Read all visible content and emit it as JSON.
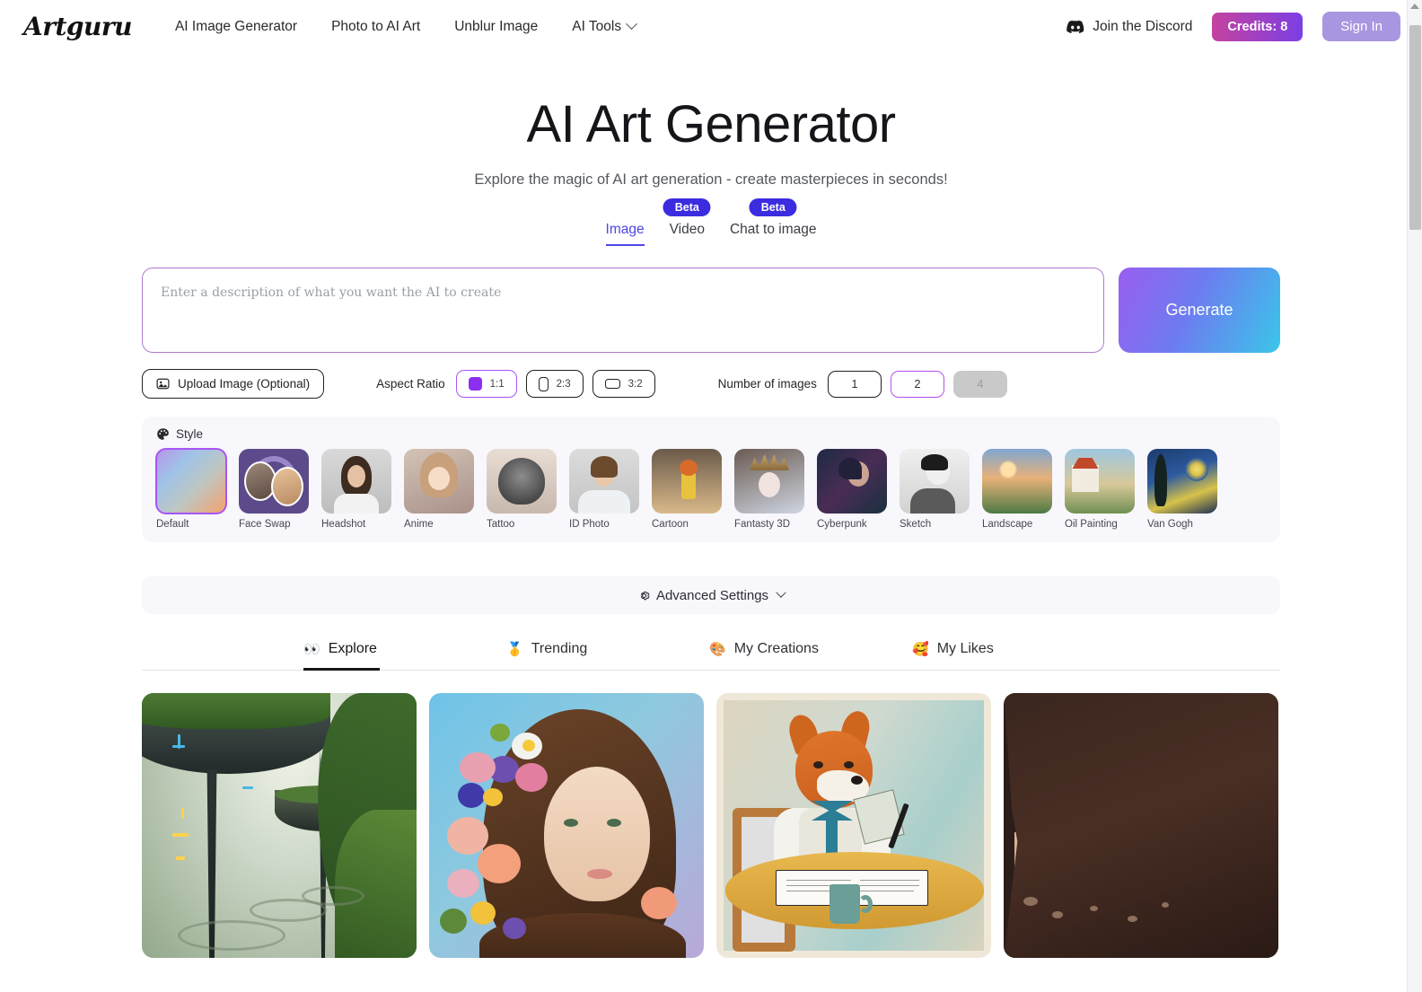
{
  "header": {
    "logo": "Artguru",
    "nav": [
      {
        "label": "AI Image Generator",
        "has_chevron": false
      },
      {
        "label": "Photo to AI Art",
        "has_chevron": false
      },
      {
        "label": "Unblur Image",
        "has_chevron": false
      },
      {
        "label": "AI Tools",
        "has_chevron": true
      }
    ],
    "discord_label": "Join the Discord",
    "discord_icon": "discord-icon",
    "credits_label": "Credits: 8",
    "signin_label": "Sign In"
  },
  "hero": {
    "title": "AI Art Generator",
    "subtitle": "Explore the magic of AI art generation - create masterpieces in seconds!"
  },
  "modes": [
    {
      "label": "Image",
      "active": true,
      "badge": ""
    },
    {
      "label": "Video",
      "active": false,
      "badge": "Beta"
    },
    {
      "label": "Chat to image",
      "active": false,
      "badge": "Beta"
    }
  ],
  "prompt": {
    "placeholder": "Enter a description of what you want the AI to create",
    "value": "",
    "generate_label": "Generate"
  },
  "options": {
    "upload_label": "Upload Image (Optional)",
    "upload_icon": "image-upload-icon",
    "aspect_ratio_label": "Aspect Ratio",
    "aspect_ratios": [
      {
        "label": "1:1",
        "selected": true
      },
      {
        "label": "2:3",
        "selected": false
      },
      {
        "label": "3:2",
        "selected": false
      }
    ],
    "number_label": "Number of images",
    "numbers": [
      {
        "label": "1",
        "selected": false,
        "disabled": false
      },
      {
        "label": "2",
        "selected": true,
        "disabled": false
      },
      {
        "label": "4",
        "selected": false,
        "disabled": true
      }
    ]
  },
  "style": {
    "heading": "Style",
    "heading_icon": "palette-icon",
    "items": [
      {
        "label": "Default",
        "selected": true
      },
      {
        "label": "Face Swap",
        "selected": false
      },
      {
        "label": "Headshot",
        "selected": false
      },
      {
        "label": "Anime",
        "selected": false
      },
      {
        "label": "Tattoo",
        "selected": false
      },
      {
        "label": "ID Photo",
        "selected": false
      },
      {
        "label": "Cartoon",
        "selected": false
      },
      {
        "label": "Fantasty 3D",
        "selected": false
      },
      {
        "label": "Cyberpunk",
        "selected": false
      },
      {
        "label": "Sketch",
        "selected": false
      },
      {
        "label": "Landscape",
        "selected": false
      },
      {
        "label": "Oil Painting",
        "selected": false
      },
      {
        "label": "Van Gogh",
        "selected": false
      }
    ]
  },
  "advanced": {
    "label": "Advanced Settings",
    "icon": "gear-icon"
  },
  "gallery_tabs": [
    {
      "label": "Explore",
      "emoji": "👀",
      "active": true
    },
    {
      "label": "Trending",
      "emoji": "🥇",
      "active": false
    },
    {
      "label": "My Creations",
      "emoji": "🎨",
      "active": false
    },
    {
      "label": "My Likes",
      "emoji": "🥰",
      "active": false
    }
  ],
  "gallery": [
    {
      "alt": "Futuristic solarpunk floating city with green terraces"
    },
    {
      "alt": "Portrait of a woman with colorful flowers in her hair"
    },
    {
      "alt": "Illustrated fox in a shirt and bow tie reading a book at a table"
    },
    {
      "alt": "Alien desert landscape with moons seen from inside a cave"
    }
  ],
  "colors": {
    "accent_purple": "#a855f7",
    "tab_indigo": "#4f46e5",
    "beta_badge": "#3b2ce0",
    "credits_gradient_start": "#c5429f",
    "credits_gradient_end": "#7b3fe4",
    "signin_bg": "#a996e0",
    "generate_gradient_start": "#9a5ef0",
    "generate_gradient_end": "#3ac6e9",
    "panel_bg": "#f8f7fc"
  }
}
